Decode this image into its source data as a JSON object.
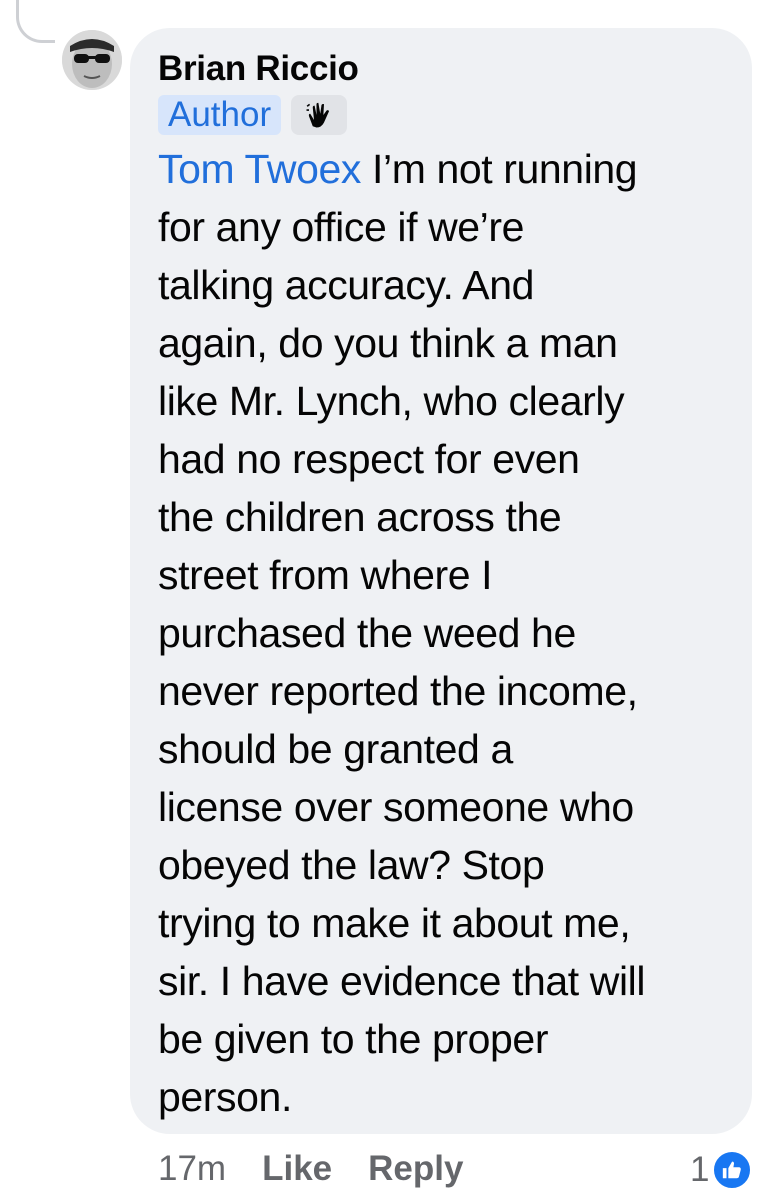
{
  "comment": {
    "author_name": "Brian Riccio",
    "author_badge": "Author",
    "wave_badge_icon": "waving-hand-icon",
    "mention": "Tom Twoex",
    "text": " I’m not running\nfor any office if we’re\ntalking accuracy. And\nagain, do you think a man\nlike Mr. Lynch, who clearly\nhad no respect for even\nthe children across the\nstreet from where I\npurchased the weed he\nnever reported the income,\nshould be granted a\nlicense over someone who\nobeyed the law? Stop\ntrying to make it about me,\nsir. I have evidence that will\nbe given to the proper\nperson."
  },
  "actions": {
    "timestamp": "17m",
    "like_label": "Like",
    "reply_label": "Reply"
  },
  "reactions": {
    "count": "1",
    "icon": "thumbs-up-icon",
    "color": "#1877f2"
  },
  "colors": {
    "bubble": "#eff1f4",
    "link": "#216fdb",
    "badge_bg": "#d7e5fb",
    "secondary_text": "#65676b"
  }
}
